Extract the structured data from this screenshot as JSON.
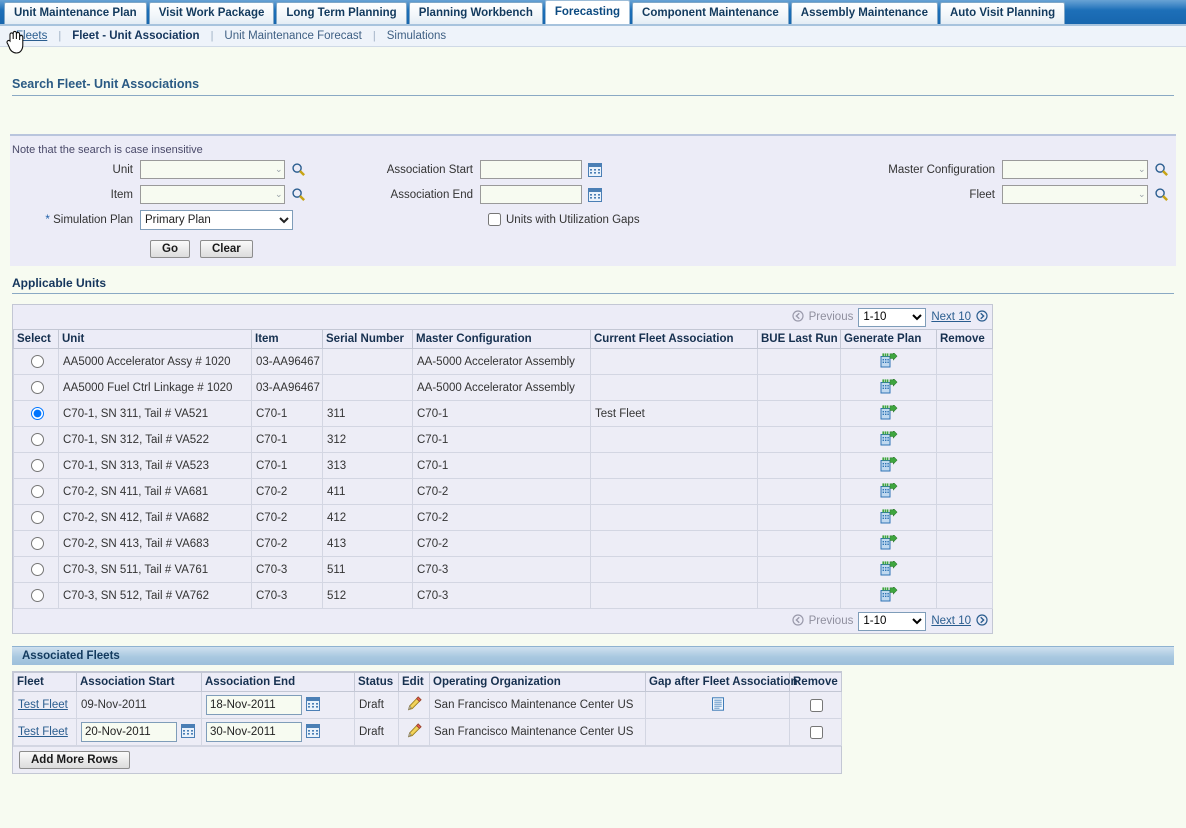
{
  "tabs": [
    {
      "label": "Unit Maintenance Plan",
      "active": false
    },
    {
      "label": "Visit Work Package",
      "active": false
    },
    {
      "label": "Long Term Planning",
      "active": false
    },
    {
      "label": "Planning Workbench",
      "active": false
    },
    {
      "label": "Forecasting",
      "active": true
    },
    {
      "label": "Component Maintenance",
      "active": false
    },
    {
      "label": "Assembly Maintenance",
      "active": false
    },
    {
      "label": "Auto Visit Planning",
      "active": false
    }
  ],
  "subnav": [
    {
      "label": "Fleets",
      "type": "link"
    },
    {
      "label": "Fleet - Unit Association",
      "type": "current"
    },
    {
      "label": "Unit Maintenance Forecast",
      "type": "plain"
    },
    {
      "label": "Simulations",
      "type": "plain"
    }
  ],
  "search": {
    "title": "Search Fleet- Unit Associations",
    "note": "Note that the search is case insensitive",
    "unit_label": "Unit",
    "unit_value": "",
    "item_label": "Item",
    "item_value": "",
    "simulation_plan_label": "Simulation Plan",
    "simulation_plan_required": "*",
    "simulation_plan_value": "Primary Plan",
    "simulation_plan_options": [
      "Primary Plan"
    ],
    "assoc_start_label": "Association Start",
    "assoc_start_value": "",
    "assoc_end_label": "Association End",
    "assoc_end_value": "",
    "gaps_checkbox_label": "Units with Utilization Gaps",
    "gaps_checked": false,
    "master_config_label": "Master Configuration",
    "master_config_value": "",
    "fleet_label": "Fleet",
    "fleet_value": "",
    "go_label": "Go",
    "clear_label": "Clear"
  },
  "units": {
    "title": "Applicable Units",
    "pager": {
      "previous_label": "Previous",
      "range_value": "1-10",
      "range_options": [
        "1-10"
      ],
      "next_label": "Next 10"
    },
    "columns": [
      "Select",
      "Unit",
      "Item",
      "Serial Number",
      "Master Configuration",
      "Current Fleet Association",
      "BUE Last Run",
      "Generate Plan",
      "Remove"
    ],
    "rows": [
      {
        "selected": false,
        "unit": "AA5000 Accelerator Assy # 1020",
        "item": "03-AA96467",
        "serial": "",
        "master_config": "AA-5000 Accelerator Assembly",
        "current_fleet": "",
        "bue_last_run": "",
        "generate_plan": "generate-plan-icon",
        "remove": ""
      },
      {
        "selected": false,
        "unit": "AA5000 Fuel Ctrl Linkage # 1020",
        "item": "03-AA96467",
        "serial": "",
        "master_config": "AA-5000 Accelerator Assembly",
        "current_fleet": "",
        "bue_last_run": "",
        "generate_plan": "generate-plan-icon",
        "remove": ""
      },
      {
        "selected": true,
        "unit": "C70-1, SN 311, Tail # VA521",
        "item": "C70-1",
        "serial": "311",
        "master_config": "C70-1",
        "current_fleet": "Test Fleet",
        "bue_last_run": "",
        "generate_plan": "generate-plan-icon",
        "remove": ""
      },
      {
        "selected": false,
        "unit": "C70-1, SN 312, Tail # VA522",
        "item": "C70-1",
        "serial": "312",
        "master_config": "C70-1",
        "current_fleet": "",
        "bue_last_run": "",
        "generate_plan": "generate-plan-icon",
        "remove": ""
      },
      {
        "selected": false,
        "unit": "C70-1, SN 313, Tail # VA523",
        "item": "C70-1",
        "serial": "313",
        "master_config": "C70-1",
        "current_fleet": "",
        "bue_last_run": "",
        "generate_plan": "generate-plan-icon",
        "remove": ""
      },
      {
        "selected": false,
        "unit": "C70-2, SN 411, Tail # VA681",
        "item": "C70-2",
        "serial": "411",
        "master_config": "C70-2",
        "current_fleet": "",
        "bue_last_run": "",
        "generate_plan": "generate-plan-icon",
        "remove": ""
      },
      {
        "selected": false,
        "unit": "C70-2, SN 412, Tail # VA682",
        "item": "C70-2",
        "serial": "412",
        "master_config": "C70-2",
        "current_fleet": "",
        "bue_last_run": "",
        "generate_plan": "generate-plan-icon",
        "remove": ""
      },
      {
        "selected": false,
        "unit": "C70-2, SN 413, Tail # VA683",
        "item": "C70-2",
        "serial": "413",
        "master_config": "C70-2",
        "current_fleet": "",
        "bue_last_run": "",
        "generate_plan": "generate-plan-icon",
        "remove": ""
      },
      {
        "selected": false,
        "unit": "C70-3, SN 511, Tail # VA761",
        "item": "C70-3",
        "serial": "511",
        "master_config": "C70-3",
        "current_fleet": "",
        "bue_last_run": "",
        "generate_plan": "generate-plan-icon",
        "remove": ""
      },
      {
        "selected": false,
        "unit": "C70-3, SN 512, Tail # VA762",
        "item": "C70-3",
        "serial": "512",
        "master_config": "C70-3",
        "current_fleet": "",
        "bue_last_run": "",
        "generate_plan": "generate-plan-icon",
        "remove": ""
      }
    ]
  },
  "fleets": {
    "title": "Associated Fleets",
    "columns": [
      "Fleet",
      "Association Start",
      "Association End",
      "Status",
      "Edit",
      "Operating Organization",
      "Gap after Fleet Association",
      "Remove"
    ],
    "rows": [
      {
        "fleet": "Test Fleet",
        "start": "09-Nov-2011",
        "start_editable": false,
        "end": "18-Nov-2011",
        "end_editable": true,
        "status": "Draft",
        "edit_icon": "pencil-icon",
        "org": "San Francisco Maintenance Center US",
        "gap_icon": "gap-report-icon",
        "remove_checked": false
      },
      {
        "fleet": "Test Fleet",
        "start": "20-Nov-2011",
        "start_editable": true,
        "end": "30-Nov-2011",
        "end_editable": true,
        "status": "Draft",
        "edit_icon": "pencil-icon",
        "org": "San Francisco Maintenance Center US",
        "gap_icon": "",
        "remove_checked": false
      }
    ],
    "add_rows_label": "Add More Rows"
  },
  "colors": {
    "tab_bar": "#1d6fb8",
    "panel": "#ececf7",
    "page_bg": "#f7fbf1",
    "link": "#2a5d8f",
    "heading": "#2a5a84"
  }
}
